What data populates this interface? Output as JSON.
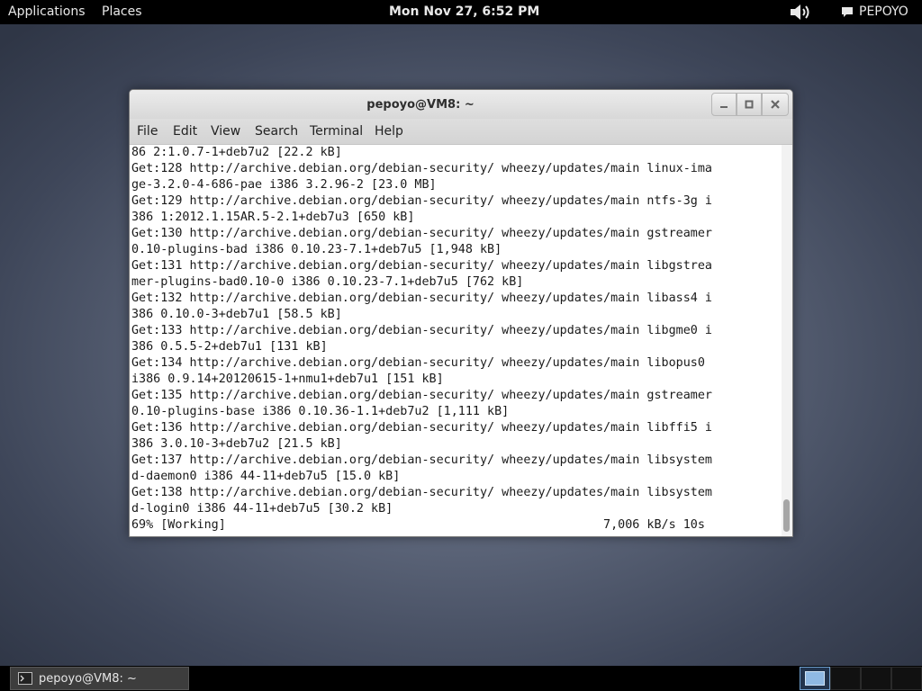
{
  "top_panel": {
    "applications": "Applications",
    "places": "Places",
    "clock": "Mon Nov 27,  6:52 PM",
    "user": "PEPOYO"
  },
  "window": {
    "title": "pepoyo@VM8: ~",
    "menu": [
      "File",
      "Edit",
      "View",
      "Search",
      "Terminal",
      "Help"
    ]
  },
  "terminal": {
    "lines": [
      "86 2:1.0.7-1+deb7u2 [22.2 kB]",
      "Get:128 http://archive.debian.org/debian-security/ wheezy/updates/main linux-ima",
      "ge-3.2.0-4-686-pae i386 3.2.96-2 [23.0 MB]",
      "Get:129 http://archive.debian.org/debian-security/ wheezy/updates/main ntfs-3g i",
      "386 1:2012.1.15AR.5-2.1+deb7u3 [650 kB]",
      "Get:130 http://archive.debian.org/debian-security/ wheezy/updates/main gstreamer",
      "0.10-plugins-bad i386 0.10.23-7.1+deb7u5 [1,948 kB]",
      "Get:131 http://archive.debian.org/debian-security/ wheezy/updates/main libgstrea",
      "mer-plugins-bad0.10-0 i386 0.10.23-7.1+deb7u5 [762 kB]",
      "Get:132 http://archive.debian.org/debian-security/ wheezy/updates/main libass4 i",
      "386 0.10.0-3+deb7u1 [58.5 kB]",
      "Get:133 http://archive.debian.org/debian-security/ wheezy/updates/main libgme0 i",
      "386 0.5.5-2+deb7u1 [131 kB]",
      "Get:134 http://archive.debian.org/debian-security/ wheezy/updates/main libopus0 ",
      "i386 0.9.14+20120615-1+nmu1+deb7u1 [151 kB]",
      "Get:135 http://archive.debian.org/debian-security/ wheezy/updates/main gstreamer",
      "0.10-plugins-base i386 0.10.36-1.1+deb7u2 [1,111 kB]",
      "Get:136 http://archive.debian.org/debian-security/ wheezy/updates/main libffi5 i",
      "386 3.0.10-3+deb7u2 [21.5 kB]",
      "Get:137 http://archive.debian.org/debian-security/ wheezy/updates/main libsystem",
      "d-daemon0 i386 44-11+deb7u5 [15.0 kB]",
      "Get:138 http://archive.debian.org/debian-security/ wheezy/updates/main libsystem",
      "d-login0 i386 44-11+deb7u5 [30.2 kB]",
      "69% [Working]                                                    7,006 kB/s 10s"
    ]
  },
  "taskbar": {
    "task_label": "pepoyo@VM8: ~"
  }
}
